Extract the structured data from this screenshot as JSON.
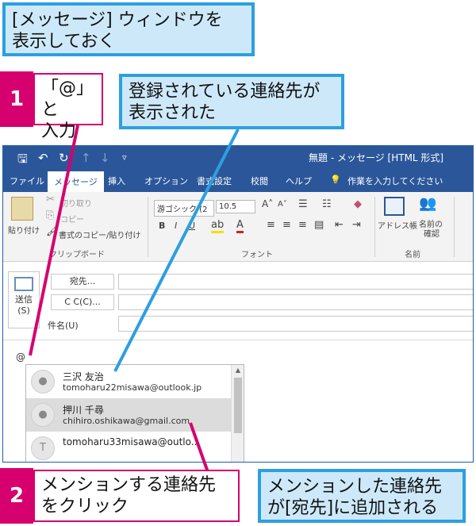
{
  "callouts": {
    "top": [
      "[メッセージ] ウィンドウを",
      "表示しておく"
    ],
    "shown": [
      "登録されている連絡先が",
      "表示された"
    ],
    "added": [
      "メンションした連絡先",
      "が[宛先]に追加される"
    ]
  },
  "steps": {
    "s1": {
      "num": "1",
      "label": [
        "「@」と",
        "入力"
      ]
    },
    "s2": {
      "num": "2",
      "label": [
        "メンションする連絡先",
        "をクリック"
      ]
    }
  },
  "window": {
    "title": "無題 - メッセージ [HTML 形式]",
    "tabs": [
      "ファイル",
      "メッセージ",
      "挿入",
      "オプション",
      "書式設定",
      "校閲",
      "ヘルプ"
    ],
    "tell_me": "作業を入力してください",
    "ribbon": {
      "paste": "貼り付け",
      "cut": "切り取り",
      "copy": "コピー",
      "format_painter": "書式のコピー/貼り付け",
      "clipboard_group": "クリップボード",
      "font_name": "游ゴシック (2",
      "font_size": "10.5",
      "font_group": "フォント",
      "address_book": "アドレス帳",
      "check_names": [
        "名前の",
        "確認"
      ],
      "names_group": "名前"
    },
    "compose": {
      "send": [
        "送信",
        "(S)"
      ],
      "to": "宛先...",
      "cc": "C C(C)...",
      "subject": "件名(U)",
      "typed": "@"
    },
    "contacts": [
      {
        "name": "三沢 友治",
        "email": "tomoharu22misawa@outlook.jp",
        "initial": ""
      },
      {
        "name": "押川 千尋",
        "email": "chihiro.oshikawa@gmail.com",
        "initial": ""
      },
      {
        "name": "tomoharu33misawa@outlo...",
        "email": "",
        "initial": "T"
      }
    ]
  }
}
